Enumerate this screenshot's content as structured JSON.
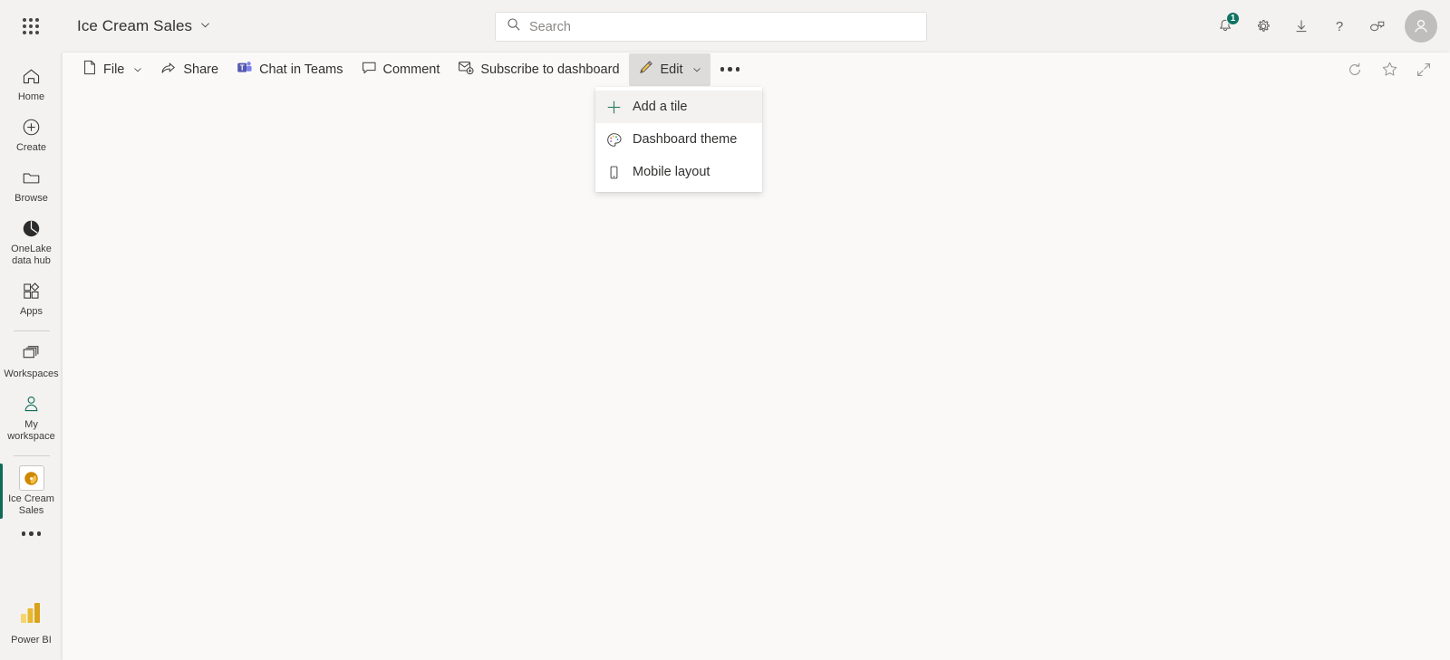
{
  "header": {
    "waffle_label": "app-launcher",
    "document_title": "Ice Cream Sales",
    "search": {
      "placeholder": "Search",
      "value": ""
    },
    "actions": [
      {
        "name": "notifications-button",
        "icon": "bell-icon",
        "badge": "1"
      },
      {
        "name": "settings-button",
        "icon": "gear-icon",
        "badge": ""
      },
      {
        "name": "download-button",
        "icon": "download-icon",
        "badge": ""
      },
      {
        "name": "help-button",
        "icon": "question-icon",
        "badge": ""
      },
      {
        "name": "feedback-button",
        "icon": "feedback-icon",
        "badge": ""
      }
    ],
    "avatar_label": "account-manager"
  },
  "sidebar": {
    "items": [
      {
        "label": "Home",
        "icon": "home-icon",
        "active": false
      },
      {
        "label": "Create",
        "icon": "plus-circle-icon",
        "active": false
      },
      {
        "label": "Browse",
        "icon": "folder-icon",
        "active": false
      },
      {
        "label": "OneLake data hub",
        "icon": "onelake-icon",
        "active": false
      },
      {
        "label": "Apps",
        "icon": "apps-icon",
        "active": false
      },
      {
        "label": "Workspaces",
        "icon": "workspaces-icon",
        "active": false
      },
      {
        "label": "My workspace",
        "icon": "person-icon",
        "active": false
      },
      {
        "label": "Ice Cream Sales",
        "icon": "dashboard-tile-icon",
        "active": true
      }
    ],
    "more_label": "more-options",
    "product_label": "Power BI"
  },
  "toolbar": {
    "file_label": "File",
    "share_label": "Share",
    "chat_in_teams_label": "Chat in Teams",
    "comment_label": "Comment",
    "subscribe_label": "Subscribe to dashboard",
    "edit_label": "Edit",
    "more_label": "More options",
    "refresh_label": "Refresh",
    "favorite_label": "Favorite",
    "fullscreen_label": "Full screen"
  },
  "edit_menu": {
    "items": [
      {
        "label": "Add a tile",
        "icon": "plus-icon",
        "hovered": true
      },
      {
        "label": "Dashboard theme",
        "icon": "palette-icon",
        "hovered": false
      },
      {
        "label": "Mobile layout",
        "icon": "phone-icon",
        "hovered": false
      }
    ]
  },
  "colors": {
    "accent_teal": "#0f6a58",
    "chrome_gray": "#f3f2f1",
    "canvas": "#faf9f8",
    "teams_purple": "#5558af",
    "pbi_yellow": "#e8a200"
  }
}
